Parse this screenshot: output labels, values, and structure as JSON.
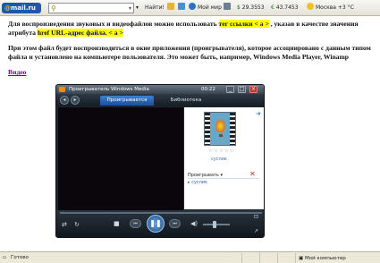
{
  "toolbar": {
    "logo_prefix": "@",
    "logo_text": "mail.ru",
    "search_placeholder": "",
    "find_label": "Найти!",
    "mymir_label": "Мой мир",
    "usd_rate": "29.3553",
    "eur_rate": "43.7453",
    "weather": "Москва +3 °C"
  },
  "document": {
    "p1_part1": "Для воспроизведения звуковых и видеофайлов можно использовать ",
    "p1_hl1": "тег ссылки < a >",
    "p1_part2": " , указав в качестве значения атрибута ",
    "p1_hl2": "href URL-адрес файла. < a >",
    "p2": "При этом файл будет воспроизводиться в окне приложения (проигрывателя), которое ассоциировано с данным типом файла и установлено на компьютере пользователя. Это может быть, например, Windows Media Player, Winamp",
    "video_link": "Видео"
  },
  "player": {
    "title": "Проигрыватель Windows Media",
    "time": "00:22",
    "tab_playing": "Проигрывается",
    "tab_library": "Библиотека",
    "thumb_label": "суслик",
    "playing_label": "Проигрывать",
    "playlist_item": "суслик"
  },
  "status": {
    "left": "Готово",
    "zone": "Мой компьютер"
  },
  "colors": {
    "highlight": "#ffff00",
    "link_visited": "#6a0d82",
    "player_accent": "#1a4f9c"
  }
}
